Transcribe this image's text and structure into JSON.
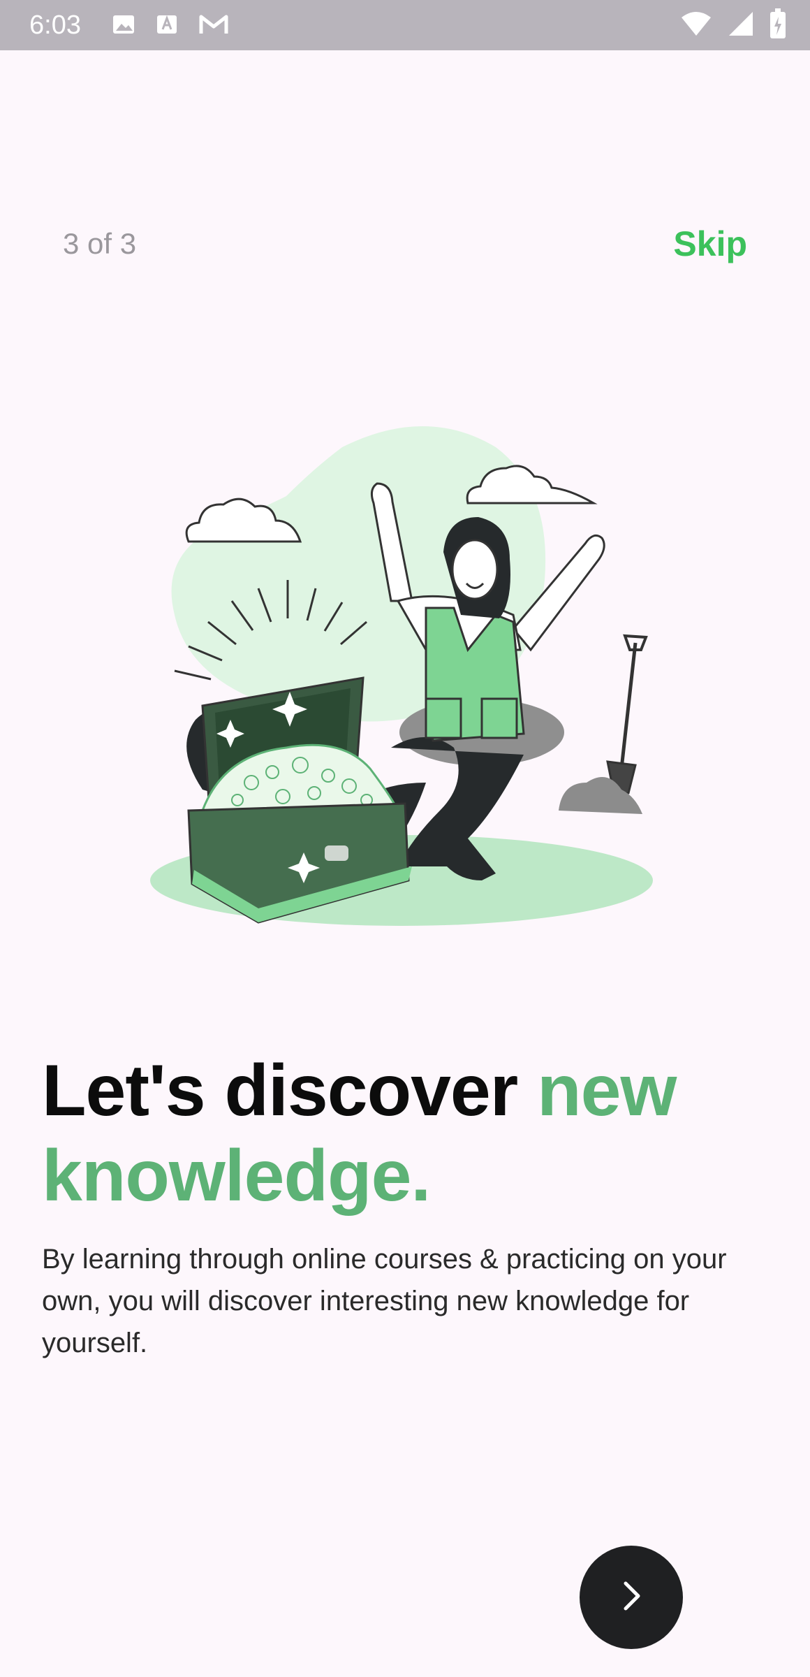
{
  "status_bar": {
    "time": "6:03",
    "left_icons": [
      "image-icon",
      "font-icon",
      "gmail-icon"
    ],
    "right_icons": [
      "wifi-icon",
      "signal-icon",
      "battery-icon"
    ]
  },
  "onboarding": {
    "step_indicator": "3 of 3",
    "skip_label": "Skip",
    "headline_main": "Let's discover ",
    "headline_accent": "new knowledge.",
    "description": "By learning through online courses & practicing on your own, you will discover interesting new knowledge for yourself.",
    "next_icon": "chevron-right-icon",
    "illustration": "treasure-chest-illustration"
  },
  "colors": {
    "background": "#fdf7fc",
    "accent_green": "#3cc15b",
    "headline_green": "#5db276",
    "button_dark": "#1f2022",
    "status_bar": "#b8b4bb"
  }
}
